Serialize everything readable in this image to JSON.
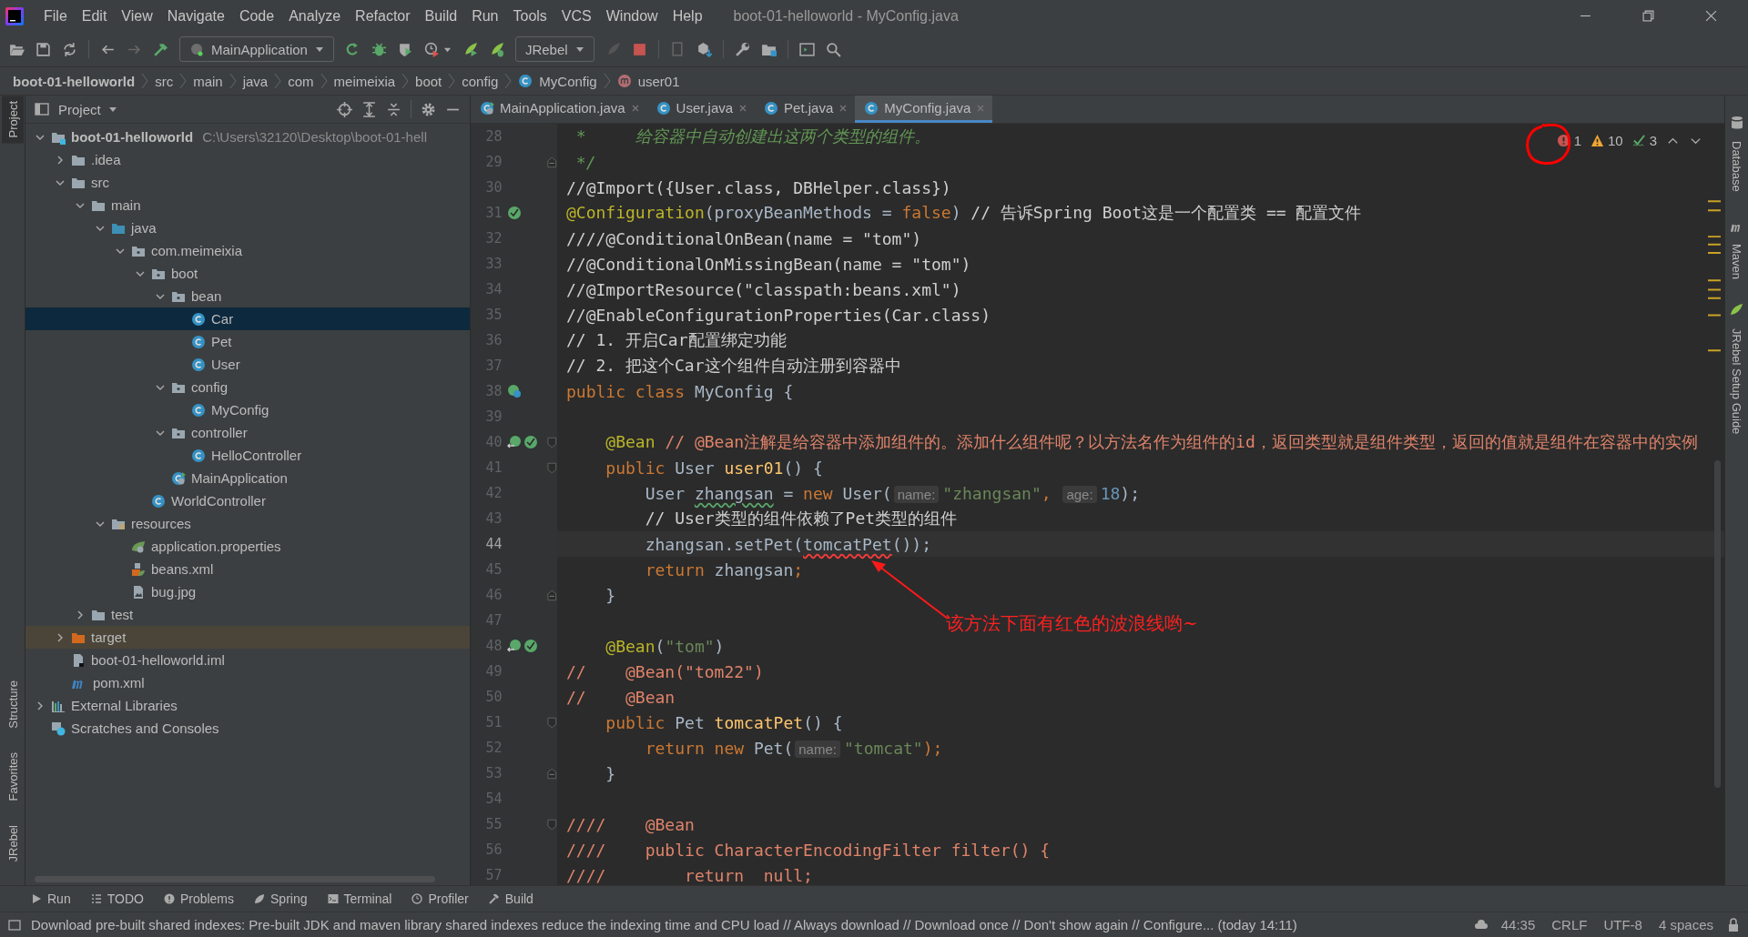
{
  "window": {
    "title": "boot-01-helloworld - MyConfig.java"
  },
  "menu": [
    "File",
    "Edit",
    "View",
    "Navigate",
    "Code",
    "Analyze",
    "Refactor",
    "Build",
    "Run",
    "Tools",
    "VCS",
    "Window",
    "Help"
  ],
  "toolbar": {
    "run_config": "MainApplication",
    "jrebel_config": "JRebel"
  },
  "breadcrumb": [
    {
      "label": "boot-01-helloworld",
      "kind": "module"
    },
    {
      "label": "src",
      "kind": "folder"
    },
    {
      "label": "main",
      "kind": "folder"
    },
    {
      "label": "java",
      "kind": "folder"
    },
    {
      "label": "com",
      "kind": "folder"
    },
    {
      "label": "meimeixia",
      "kind": "folder"
    },
    {
      "label": "boot",
      "kind": "folder"
    },
    {
      "label": "config",
      "kind": "folder"
    },
    {
      "label": "MyConfig",
      "kind": "class"
    },
    {
      "label": "user01",
      "kind": "method"
    }
  ],
  "left_strip": [
    {
      "label": "Project",
      "selected": true
    },
    {
      "label": "Structure",
      "selected": false
    },
    {
      "label": "Favorites",
      "selected": false
    },
    {
      "label": "JRebel",
      "selected": false
    }
  ],
  "right_strip": [
    {
      "label": "Database",
      "kind": "database"
    },
    {
      "label": "Maven",
      "kind": "maven"
    },
    {
      "label": "JRebel Setup Guide",
      "kind": "jrebel"
    }
  ],
  "project_panel": {
    "title": "Project"
  },
  "project_tree": [
    {
      "label": "boot-01-helloworld",
      "path": "C:\\Users\\32120\\Desktop\\boot-01-hell",
      "kind": "module",
      "expanded": true,
      "selected": false,
      "children": [
        {
          "label": ".idea",
          "kind": "folder",
          "expanded": false,
          "selected": false
        },
        {
          "label": "src",
          "kind": "folder",
          "expanded": true,
          "selected": false,
          "children": [
            {
              "label": "main",
              "kind": "folder",
              "expanded": true,
              "selected": false,
              "children": [
                {
                  "label": "java",
                  "kind": "source-folder",
                  "expanded": true,
                  "selected": false,
                  "children": [
                    {
                      "label": "com.meimeixia",
                      "kind": "package",
                      "expanded": true,
                      "selected": false,
                      "children": [
                        {
                          "label": "boot",
                          "kind": "package",
                          "expanded": true,
                          "selected": false,
                          "children": [
                            {
                              "label": "bean",
                              "kind": "package",
                              "expanded": true,
                              "selected": false,
                              "children": [
                                {
                                  "label": "Car",
                                  "kind": "class",
                                  "selected": true
                                },
                                {
                                  "label": "Pet",
                                  "kind": "class",
                                  "selected": false
                                },
                                {
                                  "label": "User",
                                  "kind": "class",
                                  "selected": false
                                }
                              ]
                            },
                            {
                              "label": "config",
                              "kind": "package",
                              "expanded": true,
                              "selected": false,
                              "children": [
                                {
                                  "label": "MyConfig",
                                  "kind": "class",
                                  "selected": false
                                }
                              ]
                            },
                            {
                              "label": "controller",
                              "kind": "package",
                              "expanded": true,
                              "selected": false,
                              "children": [
                                {
                                  "label": "HelloController",
                                  "kind": "class",
                                  "selected": false
                                }
                              ]
                            },
                            {
                              "label": "MainApplication",
                              "kind": "spring-app",
                              "selected": false
                            }
                          ]
                        },
                        {
                          "label": "WorldController",
                          "kind": "class",
                          "selected": false
                        }
                      ]
                    }
                  ]
                },
                {
                  "label": "resources",
                  "kind": "resources",
                  "expanded": true,
                  "selected": false,
                  "children": [
                    {
                      "label": "application.properties",
                      "kind": "properties",
                      "selected": false
                    },
                    {
                      "label": "beans.xml",
                      "kind": "xml",
                      "selected": false
                    },
                    {
                      "label": "bug.jpg",
                      "kind": "image",
                      "selected": false
                    }
                  ]
                }
              ]
            },
            {
              "label": "test",
              "kind": "folder",
              "expanded": false,
              "selected": false
            }
          ]
        },
        {
          "label": "target",
          "kind": "excluded-folder",
          "expanded": false,
          "selected": false
        },
        {
          "label": "boot-01-helloworld.iml",
          "kind": "iml",
          "selected": false
        },
        {
          "label": "pom.xml",
          "kind": "maven",
          "selected": false
        }
      ]
    },
    {
      "label": "External Libraries",
      "kind": "libraries",
      "expanded": false,
      "selected": false
    },
    {
      "label": "Scratches and Consoles",
      "kind": "scratches",
      "selected": false
    }
  ],
  "tabs": [
    {
      "label": "MainApplication.java",
      "kind": "spring-app",
      "selected": false
    },
    {
      "label": "User.java",
      "kind": "class",
      "selected": false
    },
    {
      "label": "Pet.java",
      "kind": "class",
      "selected": false
    },
    {
      "label": "MyConfig.java",
      "kind": "class",
      "selected": true
    }
  ],
  "inspections": {
    "errors": "1",
    "warnings": "10",
    "typos": "3"
  },
  "callout": {
    "text": "该方法下面有红色的波浪线哟~"
  },
  "lines": [
    {
      "number": "28",
      "current": false,
      "tokens": [
        {
          "kind": "doc",
          "text": " *     给容器中自动创建出这两个类型的组件。"
        }
      ]
    },
    {
      "number": "29",
      "current": false,
      "fold": {
        "kind": "end"
      },
      "tokens": [
        {
          "kind": "doc",
          "text": " */"
        }
      ]
    },
    {
      "number": "30",
      "current": false,
      "tokens": [
        {
          "kind": "comment",
          "text": "//@Import({User.class, DBHelper.class})"
        }
      ]
    },
    {
      "number": "31",
      "current": false,
      "gutter": [
        {
          "kind": "bean"
        }
      ],
      "tokens": [
        {
          "kind": "annotation",
          "text": "@Configuration"
        },
        {
          "kind": "plain",
          "text": "(proxyBeanMethods = "
        },
        {
          "kind": "keyword",
          "text": "false"
        },
        {
          "kind": "plain",
          "text": ") "
        },
        {
          "kind": "comment",
          "text": "// 告诉Spring Boot这是一个配置类 == 配置文件"
        }
      ]
    },
    {
      "number": "32",
      "current": false,
      "tokens": [
        {
          "kind": "comment",
          "text": "////@ConditionalOnBean(name = \"tom\")"
        }
      ]
    },
    {
      "number": "33",
      "current": false,
      "tokens": [
        {
          "kind": "comment",
          "text": "//@ConditionalOnMissingBean(name = \"tom\")"
        }
      ]
    },
    {
      "number": "34",
      "current": false,
      "tokens": [
        {
          "kind": "comment",
          "text": "//@ImportResource(\"classpath:beans.xml\")"
        }
      ]
    },
    {
      "number": "35",
      "current": false,
      "tokens": [
        {
          "kind": "comment",
          "text": "//@EnableConfigurationProperties(Car.class)"
        }
      ]
    },
    {
      "number": "36",
      "current": false,
      "tokens": [
        {
          "kind": "comment",
          "text": "// 1. 开启Car配置绑定功能"
        }
      ]
    },
    {
      "number": "37",
      "current": false,
      "tokens": [
        {
          "kind": "comment",
          "text": "// 2. 把这个Car这个组件自动注册到容器中"
        }
      ]
    },
    {
      "number": "38",
      "current": false,
      "gutter": [
        {
          "kind": "config"
        }
      ],
      "tokens": [
        {
          "kind": "keyword",
          "text": "public class "
        },
        {
          "kind": "plain",
          "text": "MyConfig {"
        }
      ]
    },
    {
      "number": "39",
      "current": false
    },
    {
      "number": "40",
      "current": false,
      "fold": {
        "kind": "start"
      },
      "gutter": [
        {
          "kind": "navigate"
        },
        {
          "kind": "bean"
        }
      ],
      "tokens": [
        {
          "kind": "annotation",
          "text": "    @Bean"
        },
        {
          "kind": "comment-red",
          "text": " // @Bean注解是给容器中添加组件的。添加什么组件呢？以方法名作为组件的id，返回类型就是组件类型，返回的值就是组件在容器中的实例"
        }
      ]
    },
    {
      "number": "41",
      "current": false,
      "fold": {
        "kind": "start"
      },
      "tokens": [
        {
          "kind": "keyword",
          "text": "    public "
        },
        {
          "kind": "plain",
          "text": "User "
        },
        {
          "kind": "method",
          "text": "user01"
        },
        {
          "kind": "plain",
          "text": "() {"
        }
      ]
    },
    {
      "number": "42",
      "current": false,
      "tokens": [
        {
          "kind": "plain",
          "text": "        User "
        },
        {
          "kind": "typo",
          "text": "zhangsan"
        },
        {
          "kind": "plain",
          "text": " = "
        },
        {
          "kind": "keyword",
          "text": "new "
        },
        {
          "kind": "plain",
          "text": "User("
        },
        {
          "kind": "hint",
          "text": "name:"
        },
        {
          "kind": "string",
          "text": "\"zhangsan\""
        },
        {
          "kind": "keyword",
          "text": ", "
        },
        {
          "kind": "hint",
          "text": "age:"
        },
        {
          "kind": "number",
          "text": "18"
        },
        {
          "kind": "plain",
          "text": ");"
        }
      ]
    },
    {
      "number": "43",
      "current": false,
      "tokens": [
        {
          "kind": "comment",
          "text": "        // User类型的组件依赖了Pet类型的组件"
        }
      ]
    },
    {
      "number": "44",
      "current": true,
      "tokens": [
        {
          "kind": "plain",
          "text": "        zhangsan.setPet("
        },
        {
          "kind": "error",
          "text": "tomcatPet"
        },
        {
          "kind": "plain",
          "text": "());"
        }
      ]
    },
    {
      "number": "45",
      "current": false,
      "tokens": [
        {
          "kind": "keyword",
          "text": "        return "
        },
        {
          "kind": "plain",
          "text": "zhangsan"
        },
        {
          "kind": "keyword",
          "text": ";"
        }
      ]
    },
    {
      "number": "46",
      "current": false,
      "fold": {
        "kind": "end"
      },
      "tokens": [
        {
          "kind": "plain",
          "text": "    }"
        }
      ]
    },
    {
      "number": "47",
      "current": false
    },
    {
      "number": "48",
      "current": false,
      "gutter": [
        {
          "kind": "navigate"
        },
        {
          "kind": "bean"
        }
      ],
      "tokens": [
        {
          "kind": "annotation",
          "text": "    @Bean"
        },
        {
          "kind": "plain",
          "text": "("
        },
        {
          "kind": "string",
          "text": "\"tom\""
        },
        {
          "kind": "plain",
          "text": ")"
        }
      ]
    },
    {
      "number": "49",
      "current": false,
      "tokens": [
        {
          "kind": "comment-red",
          "text": "//    @Bean(\"tom22\")"
        }
      ]
    },
    {
      "number": "50",
      "current": false,
      "tokens": [
        {
          "kind": "comment-red",
          "text": "//    @Bean"
        }
      ]
    },
    {
      "number": "51",
      "current": false,
      "fold": {
        "kind": "start"
      },
      "tokens": [
        {
          "kind": "keyword",
          "text": "    public "
        },
        {
          "kind": "plain",
          "text": "Pet "
        },
        {
          "kind": "method",
          "text": "tomcatPet"
        },
        {
          "kind": "plain",
          "text": "() {"
        }
      ]
    },
    {
      "number": "52",
      "current": false,
      "tokens": [
        {
          "kind": "keyword",
          "text": "        return new "
        },
        {
          "kind": "plain",
          "text": "Pet("
        },
        {
          "kind": "hint",
          "text": "name:"
        },
        {
          "kind": "string",
          "text": "\"tomcat\""
        },
        {
          "kind": "keyword",
          "text": ");"
        }
      ]
    },
    {
      "number": "53",
      "current": false,
      "fold": {
        "kind": "end"
      },
      "tokens": [
        {
          "kind": "plain",
          "text": "    }"
        }
      ]
    },
    {
      "number": "54",
      "current": false
    },
    {
      "number": "55",
      "current": false,
      "fold": {
        "kind": "start"
      },
      "tokens": [
        {
          "kind": "comment-red",
          "text": "////    @Bean"
        }
      ]
    },
    {
      "number": "56",
      "current": false,
      "tokens": [
        {
          "kind": "comment-red",
          "text": "////    public CharacterEncodingFilter filter() {"
        }
      ]
    },
    {
      "number": "57",
      "current": false,
      "tokens": [
        {
          "kind": "comment-red",
          "text": "////        return  null;"
        }
      ]
    }
  ],
  "tool_windows": [
    {
      "label": "Run",
      "kind": "run"
    },
    {
      "label": "TODO",
      "kind": "todo"
    },
    {
      "label": "Problems",
      "kind": "problems"
    },
    {
      "label": "Spring",
      "kind": "spring"
    },
    {
      "label": "Terminal",
      "kind": "terminal"
    },
    {
      "label": "Profiler",
      "kind": "profiler"
    },
    {
      "label": "Build",
      "kind": "build"
    }
  ],
  "status_bar": {
    "message": "Download pre-built shared indexes: Pre-built JDK and maven library shared indexes reduce the indexing time and CPU load // Always download // Download once // Don't show again // Configure... (today 14:11)",
    "position": "44:35",
    "line_separator": "CRLF",
    "encoding": "UTF-8",
    "indent": "4 spaces"
  }
}
